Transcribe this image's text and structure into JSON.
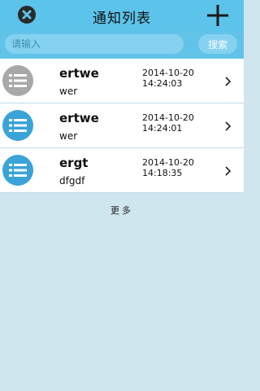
{
  "header": {
    "title": "通知列表",
    "close_icon": "close-circle-icon",
    "add_icon": "plus-icon"
  },
  "search": {
    "placeholder": "请输入",
    "button_label": "搜索"
  },
  "notifications": [
    {
      "title": "ertwe",
      "content": "wer",
      "date": "2014-10-20",
      "time": "14:24:03",
      "icon": "list-icon",
      "icon_color": "#a8a8a8"
    },
    {
      "title": "ertwe",
      "content": "wer",
      "date": "2014-10-20",
      "time": "14:24:01",
      "icon": "list-icon",
      "icon_color": "#3aa3d8"
    },
    {
      "title": "ergt",
      "content": "dfgdf",
      "date": "2014-10-20",
      "time": "14:18:35",
      "icon": "list-icon",
      "icon_color": "#3aa3d8"
    }
  ],
  "footer": {
    "more_label": "更多"
  },
  "colors": {
    "header_bg": "#5cc3ea",
    "page_bg": "#cfe6ee",
    "search_field_bg": "#84d2ef"
  }
}
